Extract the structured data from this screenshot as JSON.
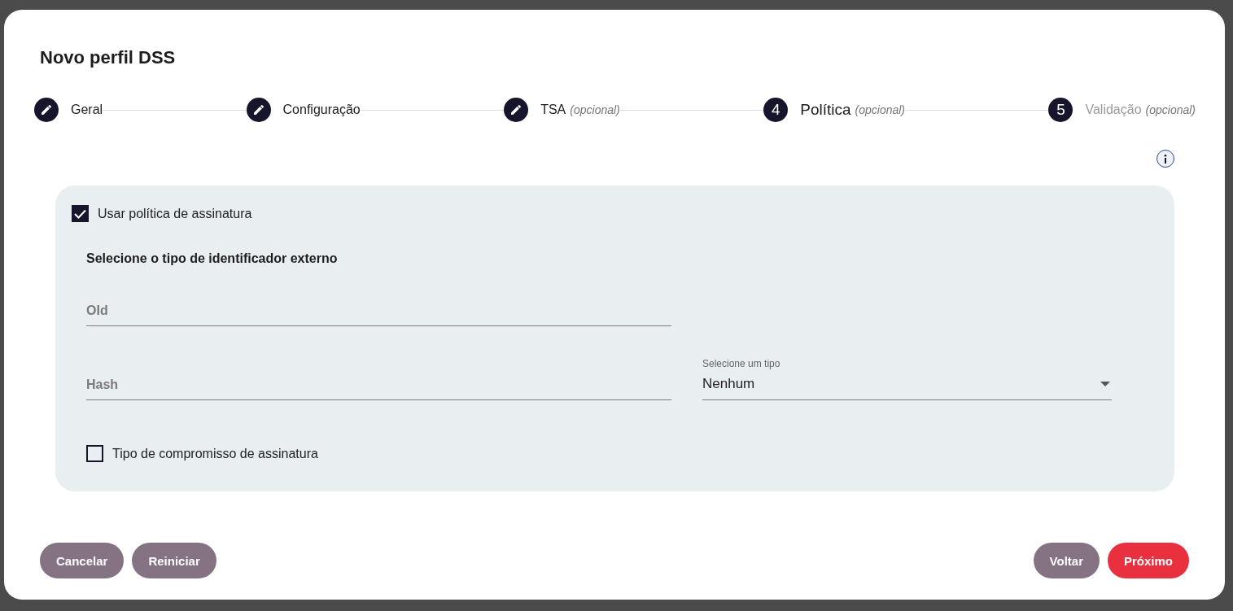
{
  "dialog": {
    "title": "Novo perfil DSS"
  },
  "steps": [
    {
      "label": "Geral",
      "completed": true,
      "selected": false
    },
    {
      "label": "Configuração",
      "completed": true,
      "selected": false
    },
    {
      "label": "TSA",
      "optional": "(opcional)",
      "completed": true,
      "selected": false
    },
    {
      "label": "Política",
      "optional": "(opcional)",
      "completed": false,
      "selected": true,
      "number": "4"
    },
    {
      "label": "Validação",
      "optional": "(opcional)",
      "completed": false,
      "selected": false,
      "number": "5"
    }
  ],
  "policy": {
    "use_policy": {
      "label": "Usar política de assinatura",
      "checked": true
    },
    "heading": "Selecione o tipo de identificador externo",
    "oid_field": {
      "placeholder": "OId"
    },
    "hash_field": {
      "placeholder": "Hash"
    },
    "hash_type": {
      "label": "Selecione um tipo",
      "value": "Nenhum"
    },
    "commitment": {
      "label": "Tipo de compromisso de assinatura",
      "checked": false
    }
  },
  "buttons_left": [
    {
      "label": "Cancelar",
      "kind": "secondary"
    },
    {
      "label": "Reiniciar",
      "kind": "secondary"
    }
  ],
  "buttons_right": [
    {
      "label": "Voltar",
      "kind": "secondary"
    },
    {
      "label": "Próximo",
      "kind": "primary"
    }
  ]
}
